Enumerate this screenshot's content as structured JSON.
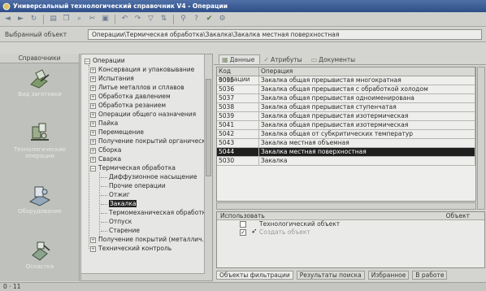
{
  "window": {
    "title": "Универсальный технологический справочник V4 - Операции"
  },
  "toolbar": {
    "icons": [
      "back-icon",
      "forward-icon",
      "refresh-icon",
      "print-icon",
      "copy-icon",
      "find-icon",
      "cut-icon",
      "paste-icon",
      "undo-icon",
      "redo-icon",
      "filter-icon",
      "sort-icon",
      "link-icon",
      "help-icon",
      "check-icon",
      "tools-icon"
    ]
  },
  "pathbar": {
    "label": "Выбранный объект",
    "path": "Операции\\Термическая обработка\\Закалка\\Закалка местная поверхностная"
  },
  "leftnav": {
    "header": "Справочники",
    "items": [
      {
        "caption": "Вид заготовки",
        "icon": "blank-type-icon"
      },
      {
        "caption": "Технологические операции",
        "icon": "operations-icon"
      },
      {
        "caption": "Оборудование",
        "icon": "equipment-icon"
      },
      {
        "caption": "Оснастка",
        "icon": "tooling-icon"
      }
    ]
  },
  "tree": {
    "rows": [
      {
        "text": "Операции",
        "toggle": "−",
        "level": 0
      },
      {
        "text": "Консервация и упаковывание",
        "toggle": "+",
        "level": 1
      },
      {
        "text": "Испытания",
        "toggle": "+",
        "level": 1
      },
      {
        "text": "Литье металлов и сплавов",
        "toggle": "+",
        "level": 1
      },
      {
        "text": "Обработка давлением",
        "toggle": "+",
        "level": 1
      },
      {
        "text": "Обработка резанием",
        "toggle": "+",
        "level": 1
      },
      {
        "text": "Операции общего назначения",
        "toggle": "+",
        "level": 1
      },
      {
        "text": "Пайка",
        "toggle": "+",
        "level": 1
      },
      {
        "text": "Перемещение",
        "toggle": "+",
        "level": 1
      },
      {
        "text": "Получение покрытий органических",
        "toggle": "+",
        "level": 1
      },
      {
        "text": "Сборка",
        "toggle": "+",
        "level": 1
      },
      {
        "text": "Сварка",
        "toggle": "+",
        "level": 1
      },
      {
        "text": "Термическая обработка",
        "toggle": "−",
        "level": 1
      },
      {
        "text": "Диффузионное насыщение",
        "toggle": "",
        "level": 2
      },
      {
        "text": "Прочие операции",
        "toggle": "",
        "level": 2
      },
      {
        "text": "Отжиг",
        "toggle": "",
        "level": 2
      },
      {
        "text": "Закалка",
        "toggle": "",
        "level": 2,
        "selected": true
      },
      {
        "text": "Термомеханическая обработка",
        "toggle": "",
        "level": 2
      },
      {
        "text": "Отпуск",
        "toggle": "",
        "level": 2
      },
      {
        "text": "Старение",
        "toggle": "",
        "level": 2
      },
      {
        "text": "Получение покрытий (металлич.)",
        "toggle": "+",
        "level": 1
      },
      {
        "text": "Технический контроль",
        "toggle": "+",
        "level": 1
      }
    ]
  },
  "tabs": [
    {
      "label": "Данные",
      "icon": "data-icon",
      "active": true
    },
    {
      "label": "Атрибуты",
      "icon": "attributes-icon",
      "active": false
    },
    {
      "label": "Документы",
      "icon": "documents-icon",
      "active": false
    }
  ],
  "grid": {
    "columns": [
      "Код операции",
      "Операция"
    ],
    "rows": [
      {
        "code": "5035",
        "name": "Закалка общая прерывистая многократная"
      },
      {
        "code": "5036",
        "name": "Закалка общая прерывистая с обработкой холодом"
      },
      {
        "code": "5037",
        "name": "Закалка общая прерывистая одноименирована"
      },
      {
        "code": "5038",
        "name": "Закалка общая прерывистая ступенчатая"
      },
      {
        "code": "5039",
        "name": "Закалка общая прерывистая изотермическая"
      },
      {
        "code": "5041",
        "name": "Закалка общая прерывистая изотермическая"
      },
      {
        "code": "5042",
        "name": "Закалка общая от субкритических температур"
      },
      {
        "code": "5043",
        "name": "Закалка местная объемная"
      },
      {
        "code": "5044",
        "name": "Закалка местная поверхностная",
        "selected": true
      },
      {
        "code": "5030",
        "name": "Закалка"
      }
    ]
  },
  "usage": {
    "header_left": "Использовать",
    "header_right": "Объект",
    "rows": [
      {
        "checked": "",
        "text": "Технологический объект"
      },
      {
        "checked": "✓",
        "text": "Создать объект",
        "hl": true
      }
    ]
  },
  "bottomtabs": [
    "Объекты фильтрации",
    "Результаты поиска",
    "Избранное",
    "В работе"
  ],
  "status": {
    "text": "0 · 11"
  }
}
